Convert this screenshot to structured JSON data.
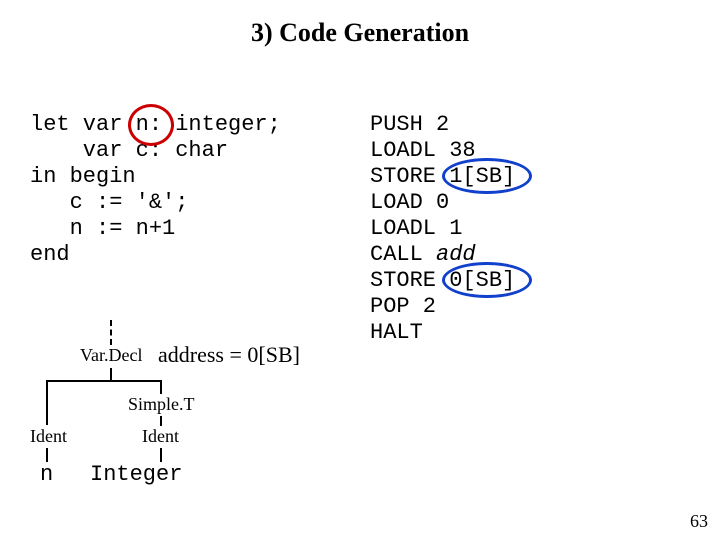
{
  "title": "3) Code Generation",
  "source": {
    "l1": "let var n: integer;",
    "l2": "    var c: char",
    "l3": "in begin",
    "l4": "   c := '&';",
    "l5": "   n := n+1",
    "l6": "end"
  },
  "target": {
    "l1": "PUSH 2",
    "l2": "LOADL 38",
    "l3a": "STORE ",
    "l3b": "1[SB]",
    "l4": "LOAD 0",
    "l5": "LOADL 1",
    "l6a": "CALL ",
    "l6b": "add",
    "l7a": "STORE ",
    "l7b": "0[SB]",
    "l8": "POP 2",
    "l9": "HALT"
  },
  "tree": {
    "vardecl": "Var.Decl",
    "address_prefix": "address = ",
    "address_value": "0[SB]",
    "simplet": "Simple.T",
    "ident1": "Ident",
    "ident2": "Ident",
    "id1": "n",
    "id2": "Integer"
  },
  "pagenum": "63"
}
